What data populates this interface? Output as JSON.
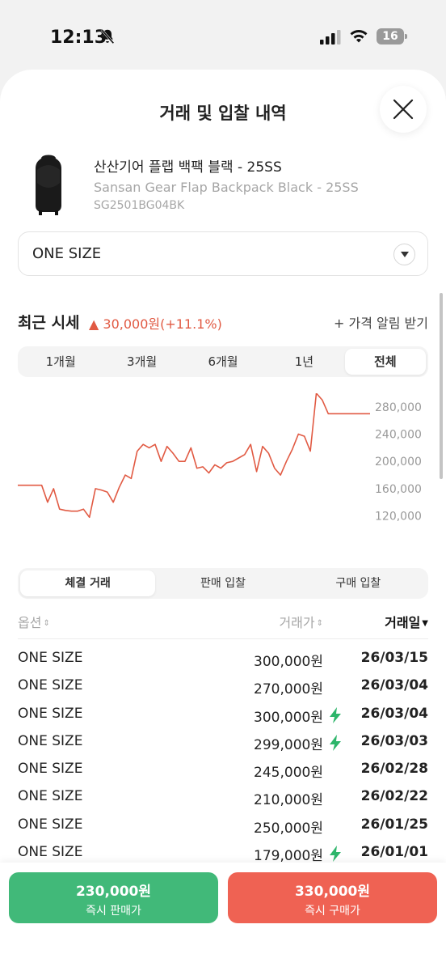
{
  "status_bar": {
    "time": "12:13",
    "battery": "16"
  },
  "sheet": {
    "title": "거래 및 입찰 내역"
  },
  "product": {
    "name_ko": "산산기어 플랩 백팩 블랙 - 25SS",
    "name_en": "Sansan Gear Flap Backpack Black - 25SS",
    "code": "SG2501BG04BK"
  },
  "size_select": {
    "value": "ONE SIZE"
  },
  "price_summary": {
    "label": "최근 시세",
    "change": "▲ 30,000원(+11.1%)",
    "alert_label": "+ 가격 알림 받기",
    "change_color": "#e15a43"
  },
  "period_tabs": [
    {
      "label": "1개월",
      "active": false
    },
    {
      "label": "3개월",
      "active": false
    },
    {
      "label": "6개월",
      "active": false
    },
    {
      "label": "1년",
      "active": false
    },
    {
      "label": "전체",
      "active": true
    }
  ],
  "chart_data": {
    "type": "line",
    "ytick_labels": [
      "280,000",
      "240,000",
      "200,000",
      "160,000",
      "120,000"
    ],
    "yticks": [
      280000,
      240000,
      200000,
      160000,
      120000
    ],
    "ylim": [
      110000,
      300000
    ],
    "line_color": "#e15a43",
    "x": [
      0,
      1,
      2,
      3,
      4,
      5,
      6,
      7,
      8,
      9,
      10,
      11,
      12,
      13,
      14,
      15,
      16,
      17,
      18,
      19,
      20,
      21,
      22,
      23,
      24,
      25,
      26,
      27,
      28,
      29,
      30,
      31,
      32,
      33,
      34,
      35,
      36,
      37,
      38,
      39,
      40,
      41,
      42,
      43,
      44,
      45,
      46,
      47,
      48,
      49,
      50,
      51,
      52,
      53,
      54,
      55,
      56,
      57,
      58,
      59
    ],
    "values": [
      165000,
      165000,
      165000,
      165000,
      165000,
      140000,
      160000,
      130000,
      128000,
      127000,
      127000,
      130000,
      118000,
      160000,
      158000,
      155000,
      140000,
      162000,
      180000,
      175000,
      215000,
      225000,
      220000,
      225000,
      200000,
      222000,
      212000,
      200000,
      200000,
      220000,
      190000,
      192000,
      183000,
      195000,
      190000,
      198000,
      200000,
      205000,
      210000,
      225000,
      185000,
      222000,
      212000,
      190000,
      180000,
      200000,
      218000,
      240000,
      237000,
      215000,
      300000,
      290000,
      270000,
      270000,
      270000,
      270000,
      270000,
      270000,
      270000,
      270000
    ]
  },
  "deal_tabs": [
    {
      "label": "체결 거래",
      "active": true
    },
    {
      "label": "판매 입찰",
      "active": false
    },
    {
      "label": "구매 입찰",
      "active": false
    }
  ],
  "table": {
    "headers": {
      "option": "옵션",
      "price": "거래가",
      "date": "거래일"
    },
    "rows": [
      {
        "option": "ONE SIZE",
        "price": "300,000원",
        "quick": false,
        "date": "26/03/15"
      },
      {
        "option": "ONE SIZE",
        "price": "270,000원",
        "quick": false,
        "date": "26/03/04"
      },
      {
        "option": "ONE SIZE",
        "price": "300,000원",
        "quick": true,
        "date": "26/03/04"
      },
      {
        "option": "ONE SIZE",
        "price": "299,000원",
        "quick": true,
        "date": "26/03/03"
      },
      {
        "option": "ONE SIZE",
        "price": "245,000원",
        "quick": false,
        "date": "26/02/28"
      },
      {
        "option": "ONE SIZE",
        "price": "210,000원",
        "quick": false,
        "date": "26/02/22"
      },
      {
        "option": "ONE SIZE",
        "price": "250,000원",
        "quick": false,
        "date": "26/01/25"
      },
      {
        "option": "ONE SIZE",
        "price": "179,000원",
        "quick": true,
        "date": "26/01/01"
      }
    ]
  },
  "actions": {
    "sell_amount": "230,000원",
    "sell_label": "즉시 판매가",
    "buy_amount": "330,000원",
    "buy_label": "즉시 구매가",
    "sell_color": "#41b979",
    "buy_color": "#ef6253"
  },
  "icons": {
    "quick_bolt": "bolt-icon",
    "close": "close-icon",
    "dropdown": "chevron-down-icon"
  }
}
